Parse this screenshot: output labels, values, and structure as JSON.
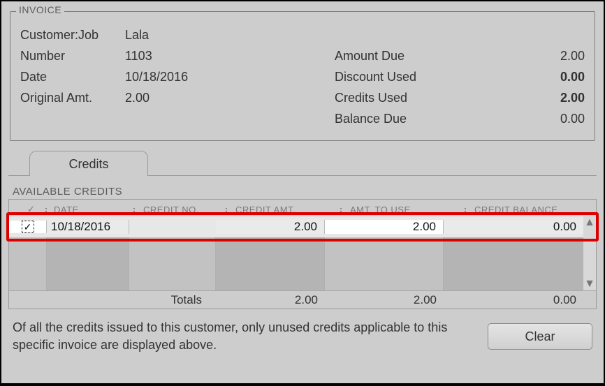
{
  "invoice": {
    "title": "INVOICE",
    "labels": {
      "customer_job": "Customer:Job",
      "number": "Number",
      "date": "Date",
      "original_amt": "Original Amt.",
      "amount_due": "Amount Due",
      "discount_used": "Discount Used",
      "credits_used": "Credits Used",
      "balance_due": "Balance Due"
    },
    "values": {
      "customer_job": "Lala",
      "number": "1103",
      "date": "10/18/2016",
      "original_amt": "2.00",
      "amount_due": "2.00",
      "discount_used": "0.00",
      "credits_used": "2.00",
      "balance_due": "0.00"
    }
  },
  "tab": {
    "label": "Credits"
  },
  "credits": {
    "section_title": "AVAILABLE CREDITS",
    "headers": {
      "check": "✓",
      "date": "DATE",
      "credit_no": "CREDIT NO.",
      "credit_amt": "CREDIT AMT.",
      "amt_to_use": "AMT. TO USE",
      "credit_balance": "CREDIT BALANCE"
    },
    "rows": [
      {
        "checked": "✓",
        "date": "10/18/2016",
        "credit_no": "",
        "credit_amt": "2.00",
        "amt_to_use": "2.00",
        "credit_balance": "0.00"
      }
    ],
    "totals": {
      "label": "Totals",
      "credit_amt": "2.00",
      "amt_to_use": "2.00",
      "credit_balance": "0.00"
    }
  },
  "footer": {
    "text": "Of all the credits issued to this customer, only unused credits applicable to this specific invoice are displayed above."
  },
  "buttons": {
    "clear": "Clear"
  }
}
